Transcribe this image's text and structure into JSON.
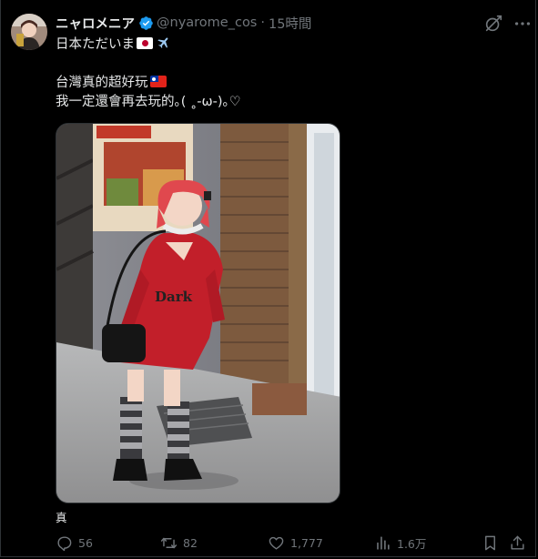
{
  "tweet": {
    "author_name": "ニャロメニア",
    "handle": "@nyarome_cos",
    "separator": "·",
    "time": "15時間",
    "line1": "日本ただいま",
    "line2": "台灣真的超好玩",
    "line3": "我一定還會再去玩的｡( ˳-ω-)｡♡",
    "photo_caption": "真"
  },
  "actions": {
    "replies": "56",
    "reposts": "82",
    "likes": "1,777",
    "views": "1.6万"
  },
  "colors": {
    "background": "#000000",
    "text": "#e7e9ea",
    "secondary": "#71767b",
    "verified": "#1d9bf0"
  },
  "icons": [
    "avatar",
    "verified-badge-icon",
    "grok-icon",
    "more-icon",
    "flag-japan-icon",
    "airplane-icon",
    "flag-taiwan-icon",
    "reply-icon",
    "repost-icon",
    "like-icon",
    "views-icon",
    "bookmark-icon",
    "share-icon"
  ]
}
